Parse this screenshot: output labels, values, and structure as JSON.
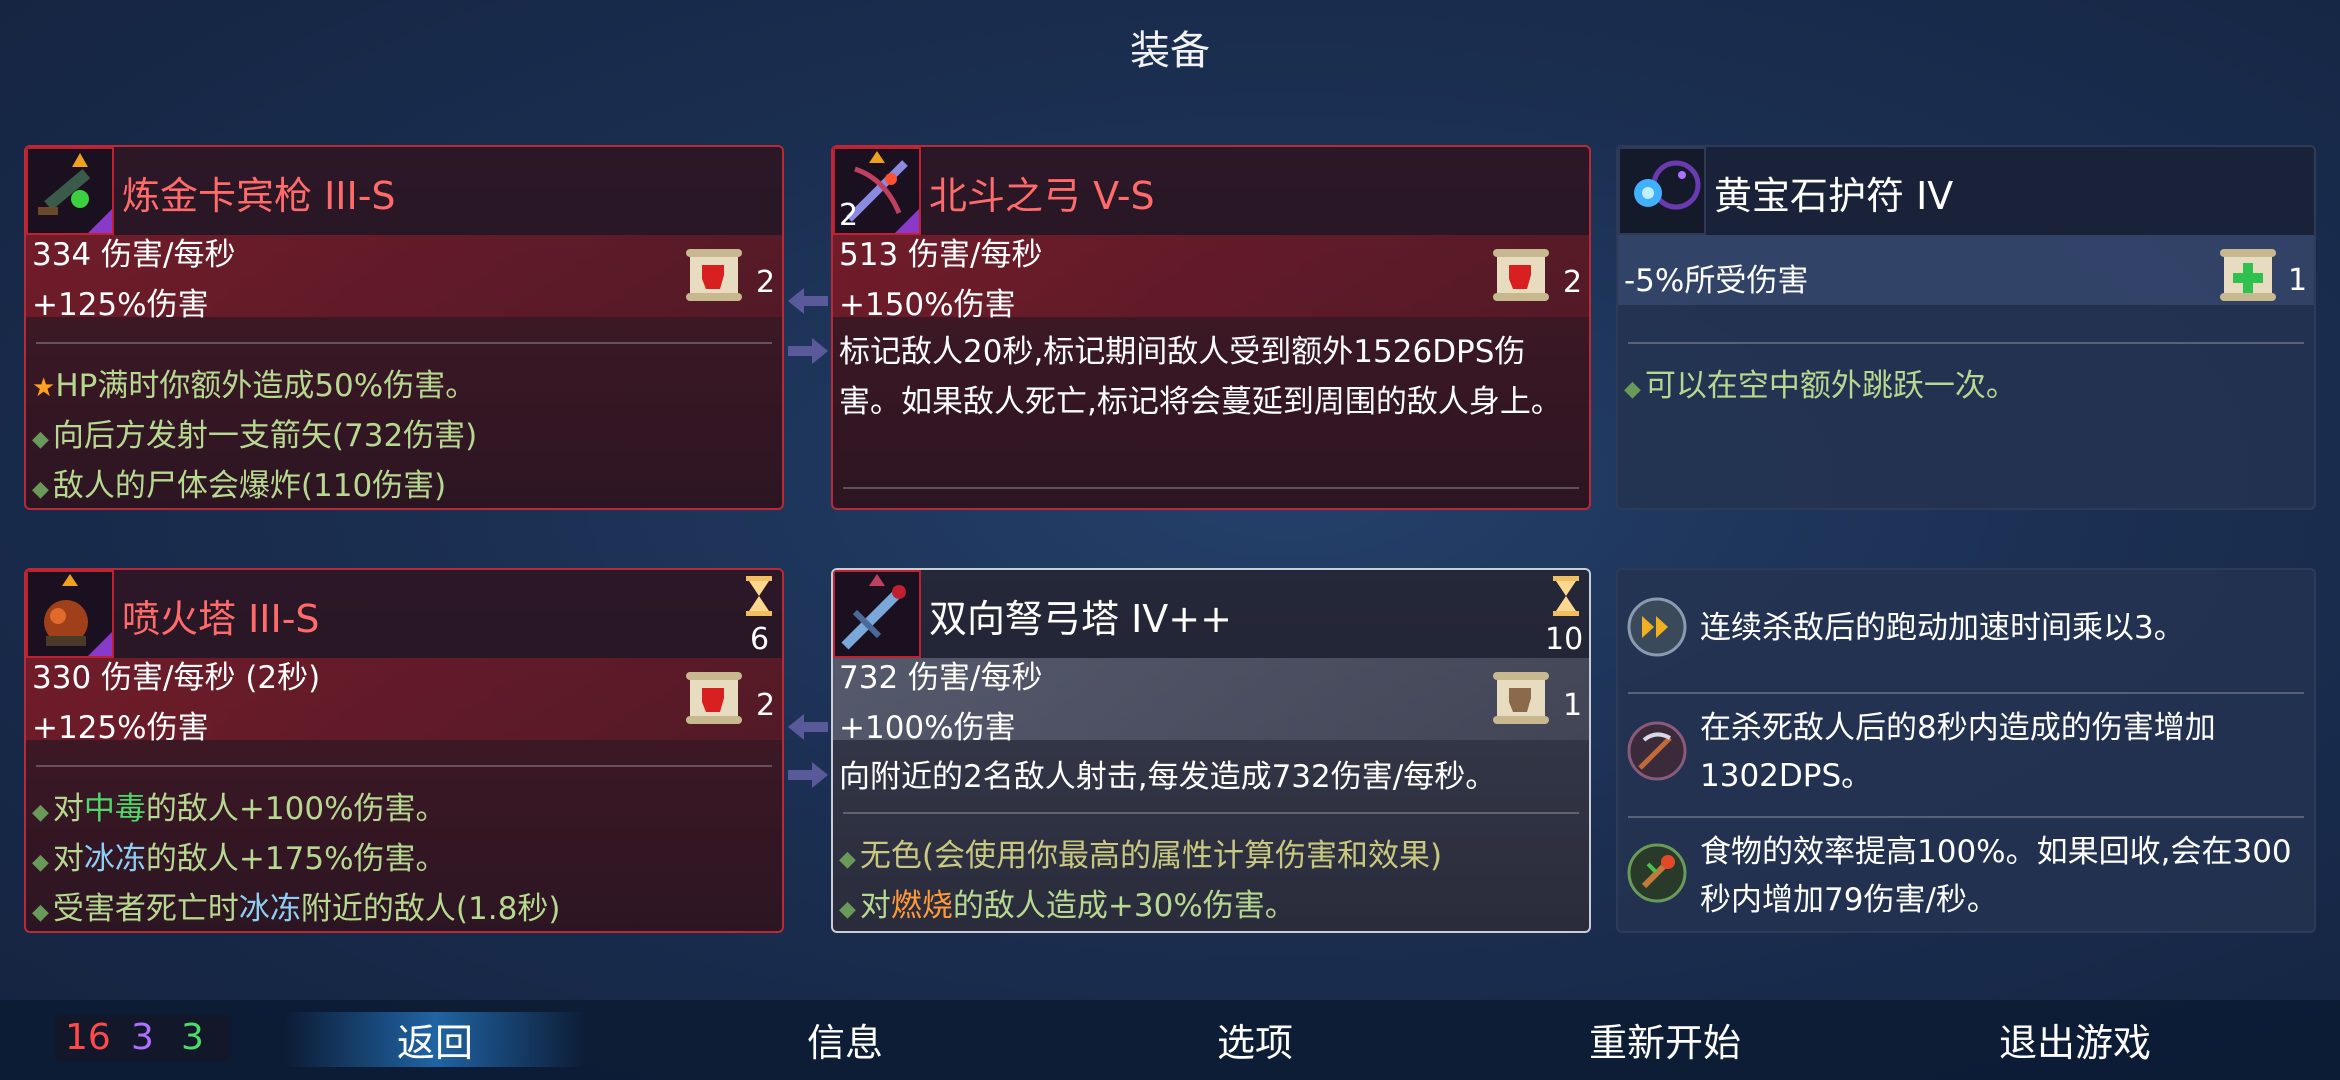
{
  "title": "装备",
  "cards": [
    {
      "name": "炼金卡宾枪 III-S",
      "stat1": "334 伤害/每秒",
      "stat2": "+125%伤害",
      "scroll_count": "2",
      "lines": [
        "HP满时你额外造成50%伤害。",
        "向后方发射一支箭矢(732伤害)",
        "敌人的尸体会爆炸(110伤害)"
      ]
    },
    {
      "name": "北斗之弓 V-S",
      "icon_badge": "2",
      "stat1": "513 伤害/每秒",
      "stat2": "+150%伤害",
      "scroll_count": "2",
      "desc": "标记敌人20秒,标记期间敌人受到额外1526DPS伤害。如果敌人死亡,标记将会蔓延到周围的敌人身上。"
    },
    {
      "name": "黄宝石护符 IV",
      "stat1": "-5%所受伤害",
      "scroll_count": "1",
      "lines": [
        "可以在空中额外跳跃一次。"
      ]
    },
    {
      "name": "喷火塔 III-S",
      "stat1": "330 伤害/每秒 (2秒)",
      "stat2": "+125%伤害",
      "scroll_count": "2",
      "hourglass_value": "6",
      "lines_rich": [
        [
          "对",
          "中毒",
          "的敌人+100%伤害。"
        ],
        [
          "对",
          "冰冻",
          "的敌人+175%伤害。"
        ],
        [
          "受害者死亡时",
          "冰冻",
          "附近的敌人(1.8秒)"
        ]
      ]
    },
    {
      "name": "双向弩弓塔 IV++",
      "stat1": "732 伤害/每秒",
      "stat2": "+100%伤害",
      "scroll_count": "1",
      "hourglass_value": "10",
      "desc": "向附近的2名敌人射击,每发造成732伤害/每秒。",
      "line1": "无色(会使用你最高的属性计算伤害和效果)",
      "line2": [
        "对",
        "燃烧",
        "的敌人造成+30%伤害。"
      ]
    }
  ],
  "passives": [
    {
      "text": "连续杀敌后的跑动加速时间乘以3。"
    },
    {
      "text": "在杀死敌人后的8秒内造成的伤害增加1302DPS。"
    },
    {
      "text": "食物的效率提高100%。如果回收,会在300秒内增加79伤害/秒。"
    }
  ],
  "levels": {
    "red": "16",
    "purple": "3",
    "green": "3",
    "colors": {
      "red": "#ff4a4a",
      "purple": "#b070ff",
      "green": "#4ddc6a"
    }
  },
  "nav": [
    "返回",
    "信息",
    "选项",
    "重新开始",
    "退出游戏"
  ]
}
